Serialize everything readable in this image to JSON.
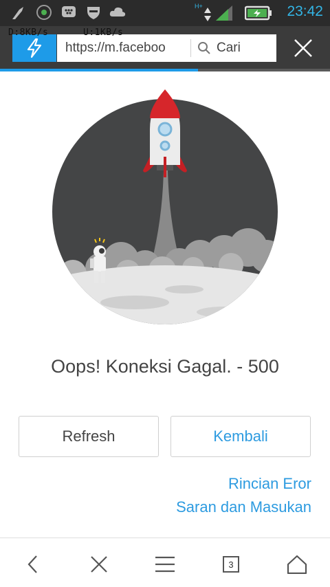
{
  "status_bar": {
    "time": "23:42",
    "network_type": "H+",
    "download_speed": "D:8KB/s",
    "upload_speed": "U:1KB/s",
    "icons": [
      "notification-icon",
      "whatsapp-icon",
      "bbm-icon",
      "shield-icon",
      "cloud-icon",
      "data-arrows-icon",
      "signal-icon",
      "battery-icon"
    ]
  },
  "address_bar": {
    "url": "https://m.faceboo",
    "search_placeholder": "Cari",
    "progress": 0.6
  },
  "error_page": {
    "message": "Oops! Koneksi Gagal. - 500",
    "refresh_label": "Refresh",
    "back_label": "Kembali",
    "error_details_link": "Rincian Eror",
    "feedback_link": "Saran dan Masukan"
  },
  "bottom_nav": {
    "tab_count": "3",
    "icons": [
      "back-icon",
      "close-icon",
      "menu-icon",
      "tabs-icon",
      "home-icon"
    ]
  },
  "colors": {
    "accent": "#1e9be8",
    "link": "#2d9be0",
    "status_time": "#33b5e5",
    "illustration_bg": "#444546",
    "rocket_red": "#d6262b"
  }
}
